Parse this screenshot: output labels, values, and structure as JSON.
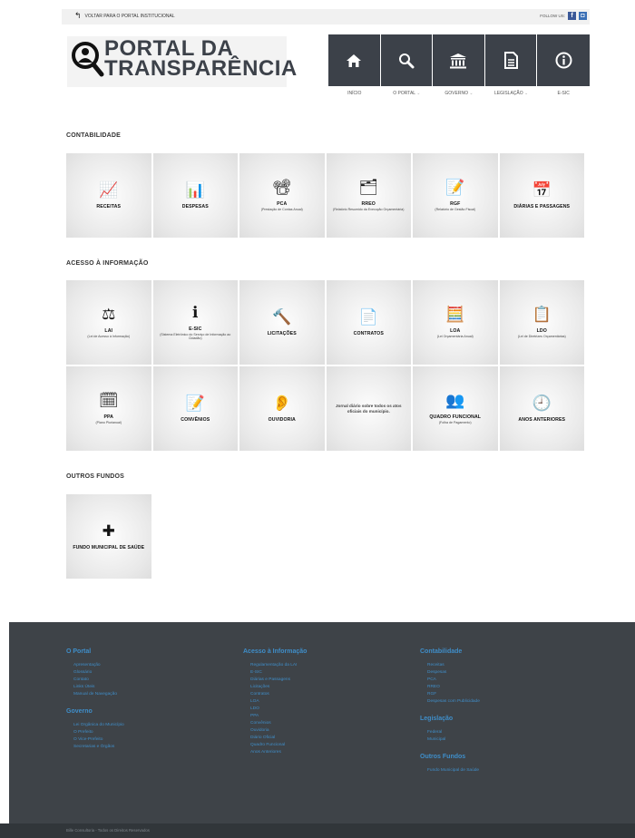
{
  "topbar": {
    "back_label": "VOLTAR PARA O PORTAL INSTITUCIONAL",
    "follow_label": "FOLLOW US:",
    "social": [
      {
        "icon": "facebook-icon",
        "glyph": "f"
      },
      {
        "icon": "instagram-icon",
        "glyph": "◘"
      }
    ]
  },
  "logo": {
    "line1": "PORTAL DA",
    "line2": "TRANSPARÊNCIA"
  },
  "nav": [
    {
      "label": "INÍCIO",
      "icon": "home-icon",
      "dropdown": false
    },
    {
      "label": "O PORTAL",
      "icon": "search-icon",
      "dropdown": true
    },
    {
      "label": "GOVERNO",
      "icon": "government-building-icon",
      "dropdown": true
    },
    {
      "label": "LEGISLAÇÃO",
      "icon": "document-icon",
      "dropdown": true
    },
    {
      "label": "E-SIC",
      "icon": "info-icon",
      "dropdown": false
    }
  ],
  "sections": [
    {
      "title": "CONTABILIDADE",
      "tiles": [
        {
          "label": "RECEITAS",
          "sub": "",
          "icon": "chart-up-icon",
          "glyph": "📈"
        },
        {
          "label": "DESPESAS",
          "sub": "",
          "icon": "bar-chart-icon",
          "glyph": "📊"
        },
        {
          "label": "PCA",
          "sub": "(Prestação de Contas Anual)",
          "icon": "presentation-board-icon",
          "glyph": "📽"
        },
        {
          "label": "RREO",
          "sub": "(Relatório Resumido da Execução Orçamentária)",
          "icon": "report-settings-icon",
          "glyph": "🗂"
        },
        {
          "label": "RGF",
          "sub": "(Relatório de Gestão Fiscal)",
          "icon": "edit-report-icon",
          "glyph": "📝"
        },
        {
          "label": "DIÁRIAS E PASSAGENS",
          "sub": "",
          "icon": "calendar-clock-icon",
          "glyph": "📅"
        }
      ]
    },
    {
      "title": "ACESSO À INFORMAÇÃO",
      "tiles": [
        {
          "label": "LAI",
          "sub": "(Lei de Acesso à Informação)",
          "icon": "scales-icon",
          "glyph": "⚖"
        },
        {
          "label": "E-SIC",
          "sub": "(Sistema Eletrônico do Serviço de Informação ao Cidadão)",
          "icon": "info-circle-icon",
          "glyph": "ℹ"
        },
        {
          "label": "LICITAÇÕES",
          "sub": "",
          "icon": "gavel-icon",
          "glyph": "🔨"
        },
        {
          "label": "CONTRATOS",
          "sub": "",
          "icon": "contract-sign-icon",
          "glyph": "📄"
        },
        {
          "label": "LOA",
          "sub": "(Lei Orçamentária Anual)",
          "icon": "calculator-icon",
          "glyph": "🧮"
        },
        {
          "label": "LDO",
          "sub": "(Lei de Diretrizes Orçamentárias)",
          "icon": "checklist-icon",
          "glyph": "📋"
        },
        {
          "label": "PPA",
          "sub": "(Plano Plurianual)",
          "icon": "clipboard-calendar-icon",
          "glyph": "🗓"
        },
        {
          "label": "CONVÊNIOS",
          "sub": "",
          "icon": "document-edit-icon",
          "glyph": "📝"
        },
        {
          "label": "OUVIDORIA",
          "sub": "",
          "icon": "ear-icon",
          "glyph": "👂"
        },
        {
          "label": "",
          "sub": "",
          "plain": "Jornal diário sobre todos os atos oficiais do município.",
          "icon": "",
          "glyph": ""
        },
        {
          "label": "QUADRO FUNCIONAL",
          "sub": "(Folha de Pagamento)",
          "icon": "users-group-icon",
          "glyph": "👥"
        },
        {
          "label": "ANOS ANTERIORES",
          "sub": "",
          "icon": "clock-icon",
          "glyph": "🕘"
        }
      ]
    },
    {
      "title": "OUTROS FUNDOS",
      "tiles": [
        {
          "label": "FUNDO MUNICIPAL DE SAÚDE",
          "sub": "",
          "icon": "health-fund-icon",
          "glyph": "✚"
        }
      ]
    }
  ],
  "footer": {
    "columns": [
      {
        "groups": [
          {
            "title": "O Portal",
            "links": [
              "Apresentação",
              "Glossário",
              "Contato",
              "Links Úteis",
              "Manual de Navegação"
            ]
          },
          {
            "title": "Governo",
            "links": [
              "Lei Orgânica do Município",
              "O Prefeito",
              "O Vice-Prefeito",
              "Secretarias e Órgãos"
            ]
          }
        ]
      },
      {
        "groups": [
          {
            "title": "Acesso à Informação",
            "links": [
              "Regulamentação da LAI",
              "E-SIC",
              "Diárias e Passagens",
              "Licitações",
              "Contratos",
              "LOA",
              "LDO",
              "PPA",
              "Convênios",
              "Ouvidoria",
              "Diário Oficial",
              "Quadro Funcional",
              "Anos Anteriores"
            ]
          }
        ]
      },
      {
        "groups": [
          {
            "title": "Contabilidade",
            "links": [
              "Receitas",
              "Despesas",
              "PCA",
              "RREO",
              "RGF",
              "Despesas com Publicidade"
            ]
          },
          {
            "title": "Legislação",
            "links": [
              "Federal",
              "Municipal"
            ]
          },
          {
            "title": "Outros Fundos",
            "links": [
              "Fundo Municipal de Saúde"
            ]
          }
        ]
      }
    ],
    "copyright": "Bille Consultoria - Todos os Direitos Reservados"
  },
  "colors": {
    "nav_bg": "#3c4149",
    "footer_bg": "#3e4348",
    "footer_link": "#3f8ec9",
    "copy_bg": "#31363a"
  }
}
